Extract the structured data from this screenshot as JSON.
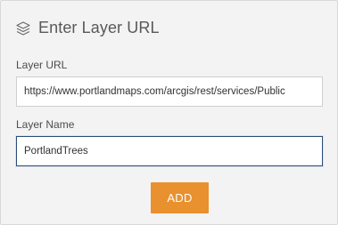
{
  "dialog": {
    "title": "Enter Layer URL",
    "title_icon": "layers-icon"
  },
  "form": {
    "layer_url": {
      "label": "Layer URL",
      "value": "https://www.portlandmaps.com/arcgis/rest/services/Public"
    },
    "layer_name": {
      "label": "Layer Name",
      "value": "PortlandTrees"
    },
    "add_button_label": "ADD"
  },
  "colors": {
    "accent_button": "#e8912e",
    "focus_border": "#2a4d7d",
    "panel_background": "#f3f3f3"
  }
}
